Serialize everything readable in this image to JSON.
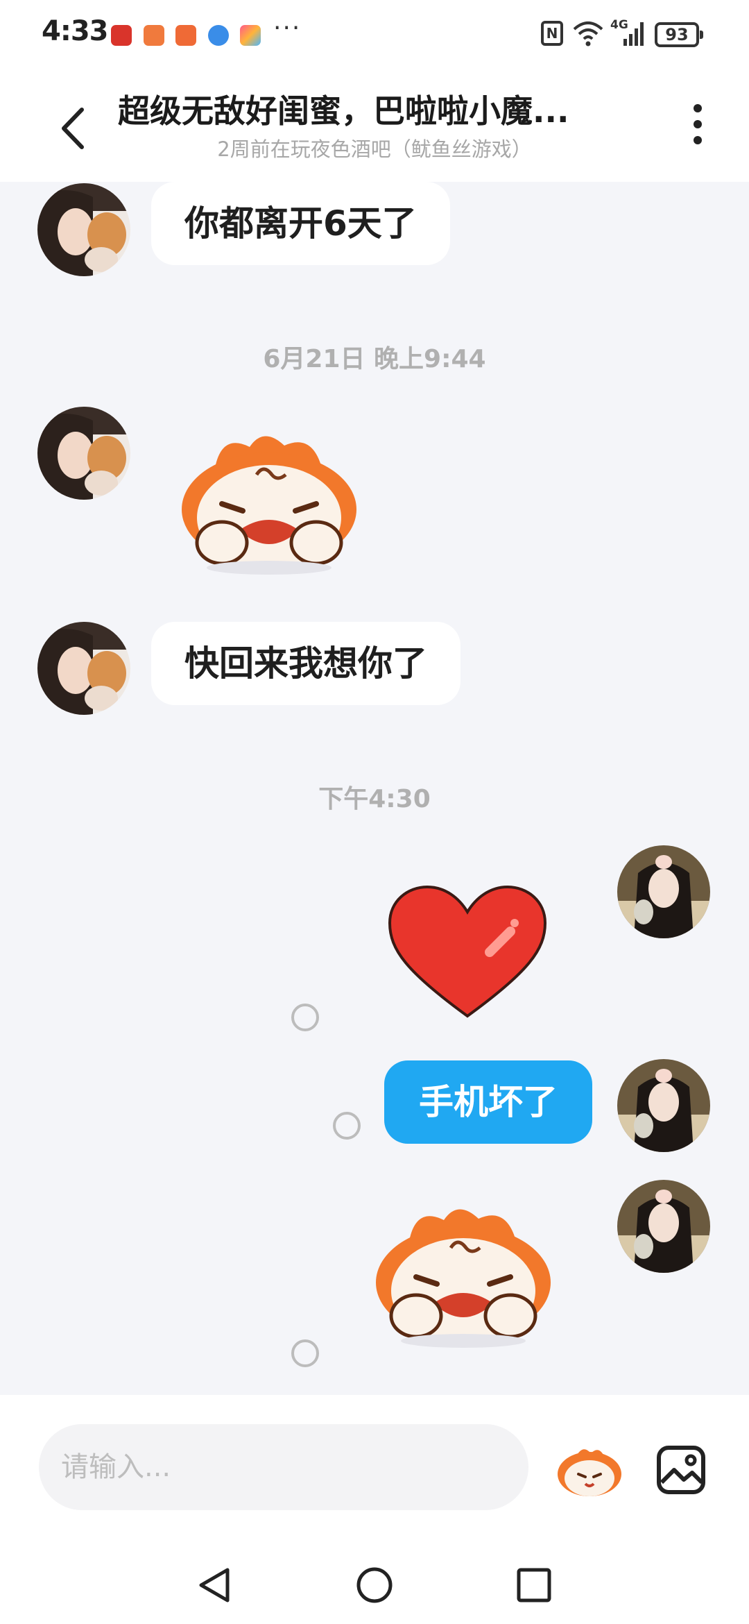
{
  "status_bar": {
    "time": "4:33",
    "overflow": "···",
    "nfc": "N",
    "network": "4G",
    "battery": "93"
  },
  "header": {
    "title": "超级无敌好闺蜜，巴啦啦小魔...",
    "subtitle": "2周前在玩夜色酒吧（鱿鱼丝游戏）"
  },
  "messages": {
    "m1": "你都离开6天了",
    "t1": "6月21日 晚上9:44",
    "m2": "快回来我想你了",
    "t2": "下午4:30",
    "m3": "手机坏了"
  },
  "input": {
    "placeholder": "请输入..."
  },
  "icons": {
    "back": "back-arrow-icon",
    "more": "more-vertical-icon",
    "emoji": "mascot-emoji-icon",
    "image": "image-icon",
    "nav_back": "triangle-back-icon",
    "nav_home": "circle-home-icon",
    "nav_recent": "square-recent-icon"
  },
  "colors": {
    "sent_bubble": "#20a8f2",
    "received_bubble": "#ffffff",
    "background": "#f4f5f9",
    "mascot_orange": "#f2782b",
    "heart_red": "#e8352c"
  }
}
